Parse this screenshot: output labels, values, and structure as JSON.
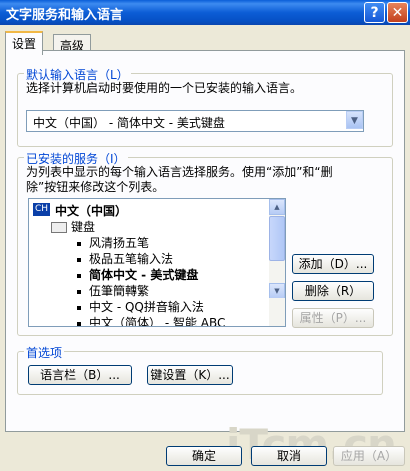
{
  "window": {
    "title": "文字服务和输入语言",
    "help_label": "?",
    "close_label": "✕"
  },
  "tabs": [
    {
      "label": "设置"
    },
    {
      "label": "高级"
    }
  ],
  "default_language": {
    "group_title": "默认输入语言（L）",
    "description": "选择计算机启动时要使用的一个已安装的输入语言。",
    "selected": "中文（中国） - 简体中文 - 美式键盘"
  },
  "installed_services": {
    "group_title": "已安装的服务（I）",
    "description_line1": "为列表中显示的每个输入语言选择服务。使用“添加”和“删",
    "description_line2": "除”按钮来修改这个列表。",
    "badge": "CH",
    "language": "中文（中国）",
    "category": "键盘",
    "items": [
      {
        "label": "风清扬五笔",
        "bold": false
      },
      {
        "label": "极品五笔输入法",
        "bold": false
      },
      {
        "label": "简体中文 - 美式键盘",
        "bold": true
      },
      {
        "label": "伍筆簡轉繁",
        "bold": false
      },
      {
        "label": "中文 - QQ拼音输入法",
        "bold": false
      },
      {
        "label": "中文（简体） - 智能 ABC",
        "bold": false
      }
    ],
    "buttons": {
      "add": "添加（D）...",
      "remove": "删除（R）",
      "properties": "属性（P）..."
    }
  },
  "preferences": {
    "group_title": "首选项",
    "language_bar_button": "语言栏（B）...",
    "key_settings_button": "键设置（K）..."
  },
  "footer": {
    "ok": "确定",
    "cancel": "取消",
    "apply": "应用（A）"
  },
  "watermark": "iTcm.cn"
}
